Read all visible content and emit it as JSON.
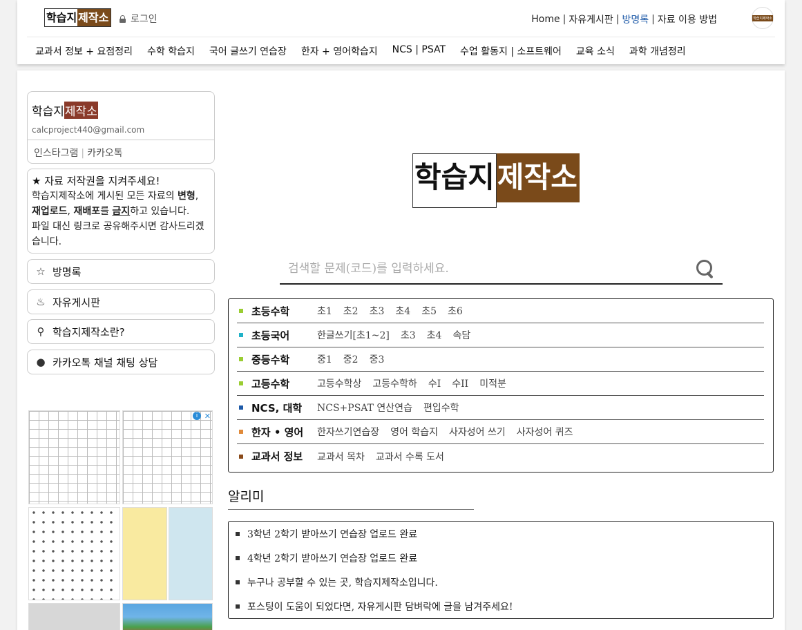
{
  "header": {
    "logo_a": "학습지",
    "logo_b": "제작소",
    "login": "로그인",
    "topnav": [
      {
        "label": "Home"
      },
      {
        "label": "자유게시판"
      },
      {
        "label": "방명록"
      },
      {
        "label": "자료 이용 방법"
      }
    ],
    "avatar_text": "학습지제작소",
    "mainnav": [
      "교과서 정보 + 요점정리",
      "수학 학습지",
      "국어 글쓰기 연습장",
      "한자 + 영어학습지",
      "NCS | PSAT",
      "수업 활동지 | 소프트웨어",
      "교육 소식",
      "과학 개념정리"
    ]
  },
  "sidebar": {
    "profile": {
      "logo_a": "학습지",
      "logo_b": "제작소",
      "email": "calcproject440@gmail.com",
      "link_instagram": "인스타그램",
      "link_kakao": "카카오톡"
    },
    "notice": {
      "title": "★ 자료 저작권을 지켜주세요!",
      "line1_pre": "학습지제작소에 게시된 모든 자료의 ",
      "line1_bold": "변형",
      "line1_post": ",",
      "line2_bold": "재업로드",
      "line2_mid": ", ",
      "line2_bold2": "재배포",
      "line2_pre_u": "를 ",
      "line2_u": "금지",
      "line2_post": "하고 있습니다.",
      "line3": "파일 대신 링크로 공유해주시면 감사드리겠습니다."
    },
    "buttons": [
      {
        "label": "방명록",
        "icon": "star-icon"
      },
      {
        "label": "자유게시판",
        "icon": "coffee-icon"
      },
      {
        "label": "학습지제작소란?",
        "icon": "bulb-icon"
      },
      {
        "label": "카카오톡 채널 채팅 상담",
        "icon": "chat-icon"
      }
    ]
  },
  "main": {
    "logo_a": "학습지",
    "logo_b": "제작소",
    "search": {
      "placeholder": "검색할 문제(코드)를 입력하세요."
    },
    "categories": [
      {
        "name": "초등수학",
        "color": "#9acd32",
        "links": [
          "초1",
          "초2",
          "초3",
          "초4",
          "초5",
          "초6"
        ]
      },
      {
        "name": "초등국어",
        "color": "#20b2c8",
        "links": [
          "한글쓰기[초1~2]",
          "초3",
          "초4",
          "속담"
        ]
      },
      {
        "name": "중등수학",
        "color": "#9acd32",
        "links": [
          "중1",
          "중2",
          "중3"
        ]
      },
      {
        "name": "고등수학",
        "color": "#9acd32",
        "links": [
          "고등수학상",
          "고등수학하",
          "수I",
          "수II",
          "미적분"
        ]
      },
      {
        "name": "NCS, 대학",
        "color": "#1e5aa8",
        "links": [
          "NCS+PSAT 연산연습",
          "편입수학"
        ]
      },
      {
        "name": "한자 • 영어",
        "color": "#e08a3a",
        "links": [
          "한자쓰기연습장",
          "영어 학습지",
          "사자성어 쓰기",
          "사자성어 퀴즈"
        ]
      },
      {
        "name": "교과서 정보",
        "color": "#8a4a1a",
        "links": [
          "교과서 목차",
          "교과서 수록 도서"
        ]
      }
    ],
    "notice_title": "알리미",
    "notices": [
      "3학년 2학기 받아쓰기 연습장 업로드 완료",
      "4학년 2학기 받아쓰기 연습장 업로드 완료",
      "누구나 공부할 수 있는 곳, 학습지제작소입니다.",
      "포스팅이 도움이 되었다면, 자유게시판 담벼락에 글을 남겨주세요!"
    ]
  }
}
